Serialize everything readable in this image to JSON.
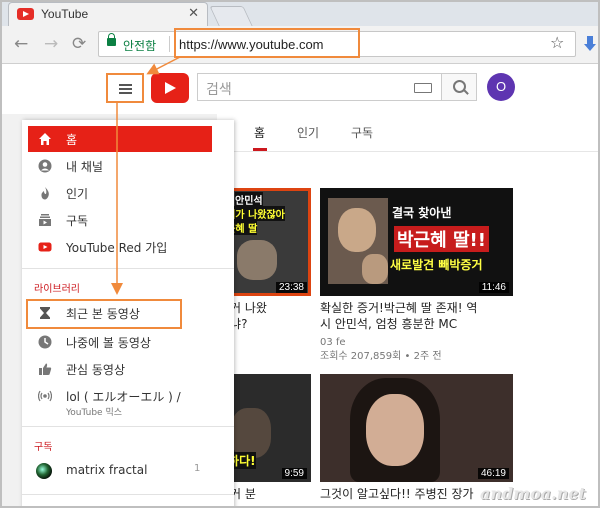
{
  "browser": {
    "tab_title": "YouTube",
    "tab_close": "✕",
    "back": "←",
    "forward": "→",
    "reload": "⟳",
    "security_label": "안전함",
    "url": "https://www.youtube.com",
    "bookmark_icon": "☆"
  },
  "header": {
    "search_placeholder": "검색",
    "avatar_letter": "O"
  },
  "content_tabs": [
    "홈",
    "인기",
    "구독"
  ],
  "sidebar": {
    "main_items": [
      {
        "icon": "home-icon",
        "label": "홈",
        "active": true
      },
      {
        "icon": "my-channel-icon",
        "label": "내 채널"
      },
      {
        "icon": "trending-icon",
        "label": "인기"
      },
      {
        "icon": "subscriptions-icon",
        "label": "구독"
      },
      {
        "icon": "youtube-red-icon",
        "label": "YouTube Red 가입"
      }
    ],
    "library_title": "라이브러리",
    "library_items": [
      {
        "icon": "history-icon",
        "label": "최근 본 동영상"
      },
      {
        "icon": "watch-later-icon",
        "label": "나중에 볼 동영상"
      },
      {
        "icon": "liked-icon",
        "label": "관심 동영상"
      },
      {
        "icon": "mix-icon",
        "label": "lol ( エルオーエル ) /",
        "sub": "YouTube 믹스"
      }
    ],
    "subs_title": "구독",
    "subs_items": [
      {
        "label": "matrix fractal",
        "count": "1"
      }
    ]
  },
  "videos": [
    {
      "thumb_lines": [
        "안민석",
        "증거가 나왔잖아",
        "박근혜 딸"
      ],
      "duration": "23:38",
      "title_lines": [
        "증거 나왔",
        "니냐?"
      ],
      "meta": [
        "",
        "전"
      ]
    },
    {
      "thumb_lines": [
        "결국 찾아낸",
        "박근혜 딸!!",
        "새로발견 빼박증거"
      ],
      "duration": "11:46",
      "title_lines": [
        "확실한 증거!박근혜 딸 존재! 역",
        "시 안민석, 엄청 흥분한 MC"
      ],
      "meta": [
        "03 fe",
        "조회수 207,859회 • 2주 전"
      ]
    },
    {
      "thumb_lines": [
        "노하다!"
      ],
      "duration": "9:59",
      "title_lines": [
        "영커 분"
      ],
      "meta": []
    },
    {
      "thumb_lines": [],
      "duration": "46:19",
      "title_lines": [
        "그것이 알고싶다!! 주병진 장가"
      ],
      "meta": []
    }
  ],
  "watermark": "andmoa.net",
  "colors": {
    "accent": "#e62117",
    "annotation": "#f08a3c",
    "secure": "#0b8043",
    "avatar": "#5e35b1"
  }
}
